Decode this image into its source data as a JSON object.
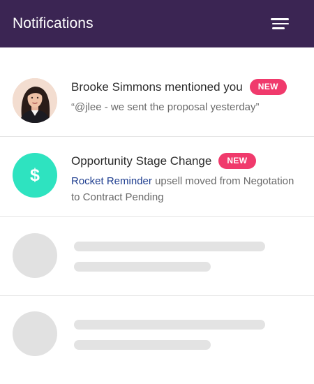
{
  "header": {
    "title": "Notifications",
    "menu_icon": "menu-icon"
  },
  "notifications": [
    {
      "title": "Brooke Simmons mentioned you",
      "badge": "NEW",
      "message": "“@jlee - we sent the proposal yesterday”",
      "avatar": "user-photo"
    },
    {
      "title": "Opportunity Stage Change",
      "badge": "NEW",
      "link_text": "Rocket Reminder",
      "message": "upsell moved from Negotation to Contract Pending",
      "avatar_symbol": "$"
    }
  ],
  "colors": {
    "header_bg": "#3b2553",
    "badge": "#f03a6c",
    "accent_teal": "#2ee3c0",
    "link": "#1e3d8f",
    "skeleton": "#e1e1e1"
  }
}
